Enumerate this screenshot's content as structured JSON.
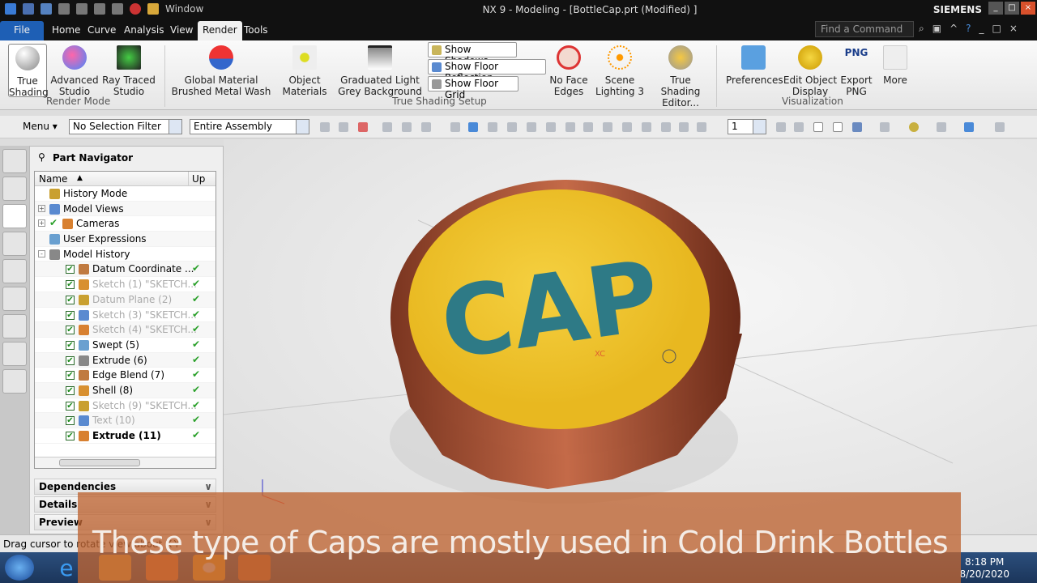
{
  "window": {
    "title": "NX 9 - Modeling - [BottleCap.prt (Modified) ]",
    "brand": "SIEMENS",
    "quick_access_window": "Window"
  },
  "tabs": [
    {
      "label": "File"
    },
    {
      "label": "Home"
    },
    {
      "label": "Curve"
    },
    {
      "label": "Analysis"
    },
    {
      "label": "View"
    },
    {
      "label": "Render",
      "active": true
    },
    {
      "label": "Tools"
    }
  ],
  "search": {
    "placeholder": "Find a Command"
  },
  "ribbon": {
    "render_mode": {
      "group": "Render Mode",
      "buttons": [
        {
          "l1": "True",
          "l2": "Shading"
        },
        {
          "l1": "Advanced",
          "l2": "Studio"
        },
        {
          "l1": "Ray Traced",
          "l2": "Studio"
        }
      ]
    },
    "true_shading_setup": {
      "group": "True Shading Setup",
      "global_material": {
        "l1": "Global Material",
        "l2": "Brushed Metal Wash"
      },
      "object_materials": {
        "l1": "Object",
        "l2": "Materials"
      },
      "background": {
        "l1": "Graduated Light",
        "l2": "Grey Background"
      },
      "toggles": [
        "Show Shadows",
        "Show Floor Reflection",
        "Show Floor Grid"
      ],
      "face_edges": {
        "l1": "No Face",
        "l2": "Edges"
      },
      "lighting": {
        "l1": "Scene",
        "l2": "Lighting 3"
      },
      "editor": {
        "l1": "True Shading",
        "l2": "Editor..."
      }
    },
    "visualization": {
      "group": "Visualization",
      "buttons": [
        {
          "l1": "Preferences",
          "l2": ""
        },
        {
          "l1": "Edit Object",
          "l2": "Display"
        },
        {
          "l1": "Export",
          "l2": "PNG"
        },
        {
          "l1": "More",
          "l2": ""
        }
      ],
      "png_label": "PNG"
    }
  },
  "toolbar": {
    "menu": "Menu",
    "selection_filter": "No Selection Filter",
    "assembly_scope": "Entire Assembly",
    "layer": "1"
  },
  "navigator": {
    "title": "Part Navigator",
    "columns": [
      "Name",
      "Up to"
    ],
    "items": [
      {
        "label": "History Mode",
        "style": "normal",
        "indent": 1
      },
      {
        "label": "Model Views",
        "style": "normal",
        "indent": 1,
        "expander": "+"
      },
      {
        "label": "Cameras",
        "style": "normal",
        "indent": 2,
        "expander": "+"
      },
      {
        "label": "User Expressions",
        "style": "normal",
        "indent": 1
      },
      {
        "label": "Model History",
        "style": "normal",
        "indent": 1,
        "expander": "-"
      },
      {
        "label": "Datum Coordinate ...",
        "style": "normal",
        "feature": true
      },
      {
        "label": "Sketch (1) \"SKETCH...",
        "style": "dim",
        "feature": true
      },
      {
        "label": "Datum Plane (2)",
        "style": "dim",
        "feature": true
      },
      {
        "label": "Sketch (3) \"SKETCH...",
        "style": "dim",
        "feature": true
      },
      {
        "label": "Sketch (4) \"SKETCH...",
        "style": "dim",
        "feature": true
      },
      {
        "label": "Swept (5)",
        "style": "normal",
        "feature": true
      },
      {
        "label": "Extrude (6)",
        "style": "normal",
        "feature": true
      },
      {
        "label": "Edge Blend (7)",
        "style": "normal",
        "feature": true
      },
      {
        "label": "Shell (8)",
        "style": "normal",
        "feature": true
      },
      {
        "label": "Sketch (9) \"SKETCH...",
        "style": "dim",
        "feature": true
      },
      {
        "label": "Text (10)",
        "style": "dim",
        "feature": true
      },
      {
        "label": "Extrude (11)",
        "style": "bold",
        "feature": true
      }
    ],
    "panels": [
      "Dependencies",
      "Details",
      "Preview"
    ]
  },
  "viewport": {
    "cap_text": "CAP",
    "axis_label": "XC",
    "colors": {
      "cap_top": "#f0c832",
      "cap_text": "#2e7a86",
      "cap_metal": "#9a4a2e"
    }
  },
  "status": {
    "text": "Drag cursor to rotate view about X-Y"
  },
  "caption": {
    "text": "These type of Caps are mostly used in Cold Drink Bottles"
  },
  "taskbar": {
    "time": "8:18 PM",
    "date": "8/20/2020"
  }
}
